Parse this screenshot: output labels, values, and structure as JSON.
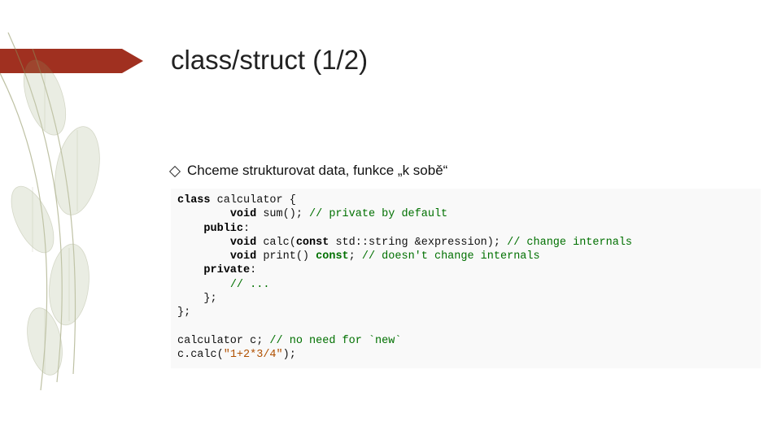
{
  "title": "class/struct (1/2)",
  "bullet": "Chceme strukturovat data, funkce „k sobě“",
  "code": {
    "kw_class": "class",
    "cls_name": "calculator",
    "obr": " {",
    "l2a": "        ",
    "l2b": "void",
    "l2c": " sum(); ",
    "l2d": "// private by default",
    "l3a": "    ",
    "l3b": "public",
    "l3c": ":",
    "l4a": "        ",
    "l4b": "void",
    "l4c": " calc(",
    "l4d": "const",
    "l4e": " std::string &expression); ",
    "l4f": "// change internals",
    "l5a": "        ",
    "l5b": "void",
    "l5c": " print() ",
    "l5d": "const",
    "l5e": "; ",
    "l5f": "// doesn't change internals",
    "l6a": "    ",
    "l6b": "private",
    "l6c": ":",
    "l7a": "        ",
    "l7b": "// ...",
    "l8": "    };",
    "l9": "};",
    "blank": " ",
    "l11a": "calculator c; ",
    "l11b": "// no need for `new`",
    "l12a": "c.calc(",
    "l12b": "\"1+2*3/4\"",
    "l12c": ");"
  }
}
